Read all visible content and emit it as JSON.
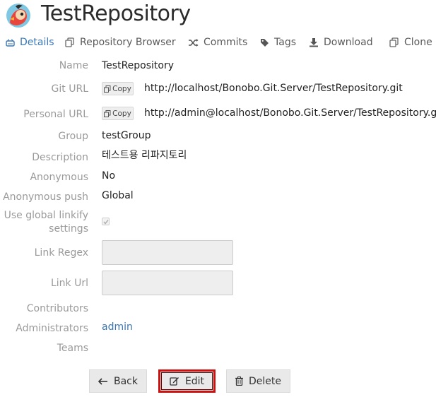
{
  "header": {
    "title": "TestRepository"
  },
  "tabs": [
    {
      "label": "Details",
      "icon": "hdd-icon",
      "active": true
    },
    {
      "label": "Repository Browser",
      "icon": "copy-icon"
    },
    {
      "label": "Commits",
      "icon": "shuffle-icon"
    },
    {
      "label": "Tags",
      "icon": "tag-icon"
    },
    {
      "label": "Download",
      "icon": "download-icon"
    },
    {
      "label": "Clone",
      "icon": "clone-icon"
    }
  ],
  "details": {
    "name_label": "Name",
    "name_value": "TestRepository",
    "git_url_label": "Git URL",
    "git_url_copy": "Copy",
    "git_url_value": "http://localhost/Bonobo.Git.Server/TestRepository.git",
    "personal_url_label": "Personal URL",
    "personal_url_copy": "Copy",
    "personal_url_value": "http://admin@localhost/Bonobo.Git.Server/TestRepository.git",
    "group_label": "Group",
    "group_value": "testGroup",
    "description_label": "Description",
    "description_value": "테스트용 리파지토리",
    "anonymous_label": "Anonymous",
    "anonymous_value": "No",
    "anonymous_push_label": "Anonymous push",
    "anonymous_push_value": "Global",
    "linkify_label_1": "Use global linkify",
    "linkify_label_2": "settings",
    "linkify_checked": true,
    "link_regex_label": "Link Regex",
    "link_regex_value": "",
    "link_url_label": "Link Url",
    "link_url_value": "",
    "contributors_label": "Contributors",
    "administrators_label": "Administrators",
    "administrators_value": "admin",
    "teams_label": "Teams"
  },
  "actions": {
    "back": "Back",
    "edit": "Edit",
    "delete": "Delete"
  },
  "colors": {
    "link": "#3a76b4",
    "label": "#9a9a9a",
    "highlight": "#cc1111"
  }
}
